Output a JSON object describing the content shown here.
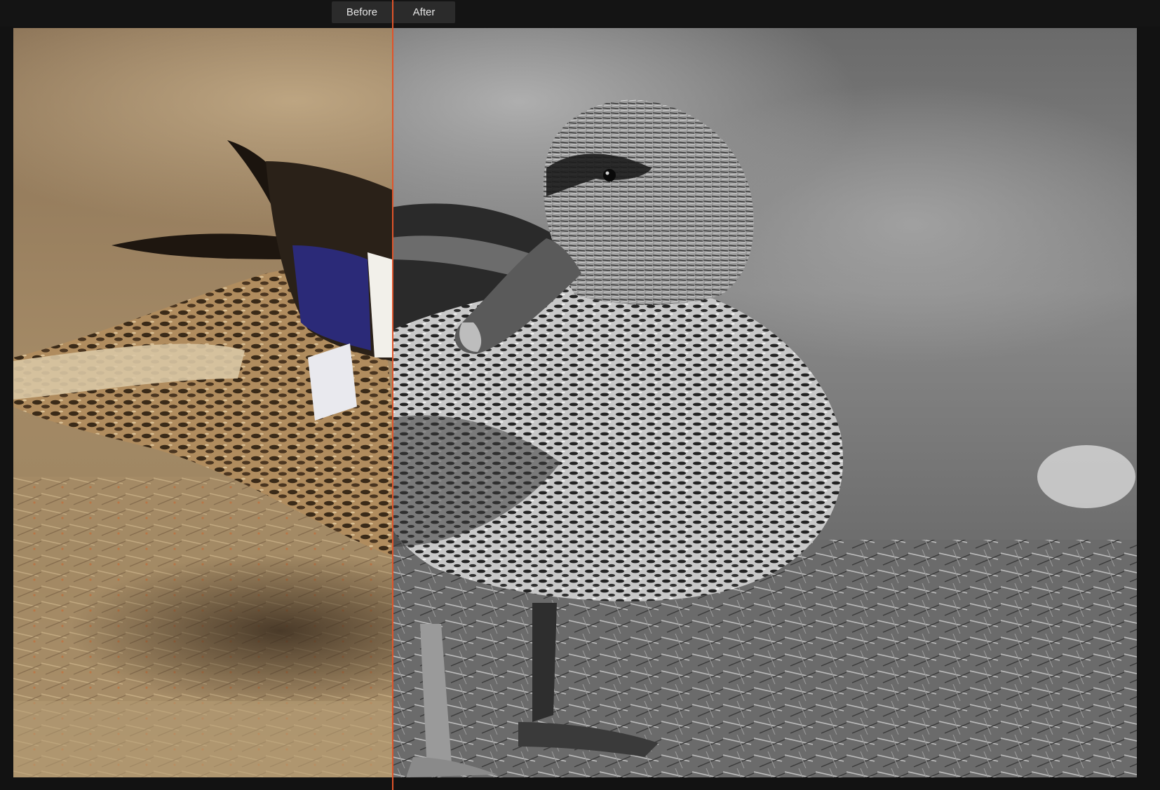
{
  "toolbar": {
    "before_label": "Before",
    "after_label": "After"
  },
  "compare": {
    "split_position_percent": 33.8,
    "divider_color": "#e0542a"
  },
  "colors": {
    "background": "#121212",
    "tab_background": "#2b2b2b",
    "tab_text": "#e6e6e6"
  },
  "image": {
    "subject": "duck-photo",
    "before_mode": "color",
    "after_mode": "black-and-white"
  }
}
